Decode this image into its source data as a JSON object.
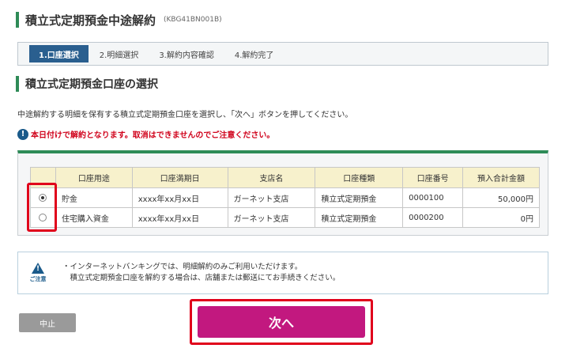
{
  "header": {
    "title": "積立式定期預金中途解約",
    "code": "(KBG41BN001B)"
  },
  "steps": [
    "1.口座選択",
    "2.明細選択",
    "3.解約内容確認",
    "4.解約完了"
  ],
  "section": {
    "title": "積立式定期預金口座の選択"
  },
  "instruction": "中途解約する明細を保有する積立式定期預金口座を選択し、「次へ」ボタンを押してください。",
  "warning": {
    "icon": "!",
    "text": "本日付けで解約となります。取消はできませんのでご注意ください。"
  },
  "table": {
    "headers": [
      "",
      "口座用途",
      "口座満期日",
      "支店名",
      "口座種類",
      "口座番号",
      "預入合計金額"
    ],
    "rows": [
      {
        "selected": true,
        "usage": "貯金",
        "maturity": "xxxx年xx月xx日",
        "branch": "ガーネット支店",
        "type": "積立式定期預金",
        "number": "0000100",
        "amount": "50,000円"
      },
      {
        "selected": false,
        "usage": "住宅購入資金",
        "maturity": "xxxx年xx月xx日",
        "branch": "ガーネット支店",
        "type": "積立式定期預金",
        "number": "0000200",
        "amount": "0円"
      }
    ]
  },
  "notice": {
    "icon_label": "ご注意",
    "lines": [
      "・インターネットバンキングでは、明細解約のみご利用いただけます。",
      "　積立式定期預金口座を解約する場合は、店舗または郵送にてお手続きください。"
    ]
  },
  "buttons": {
    "cancel": "中止",
    "next": "次へ"
  },
  "colors": {
    "accent_green": "#2e8b57",
    "step_active": "#2a5f8f",
    "next_button": "#c2187f",
    "highlight_red": "#e0001b",
    "warning_red": "#d0021b"
  }
}
